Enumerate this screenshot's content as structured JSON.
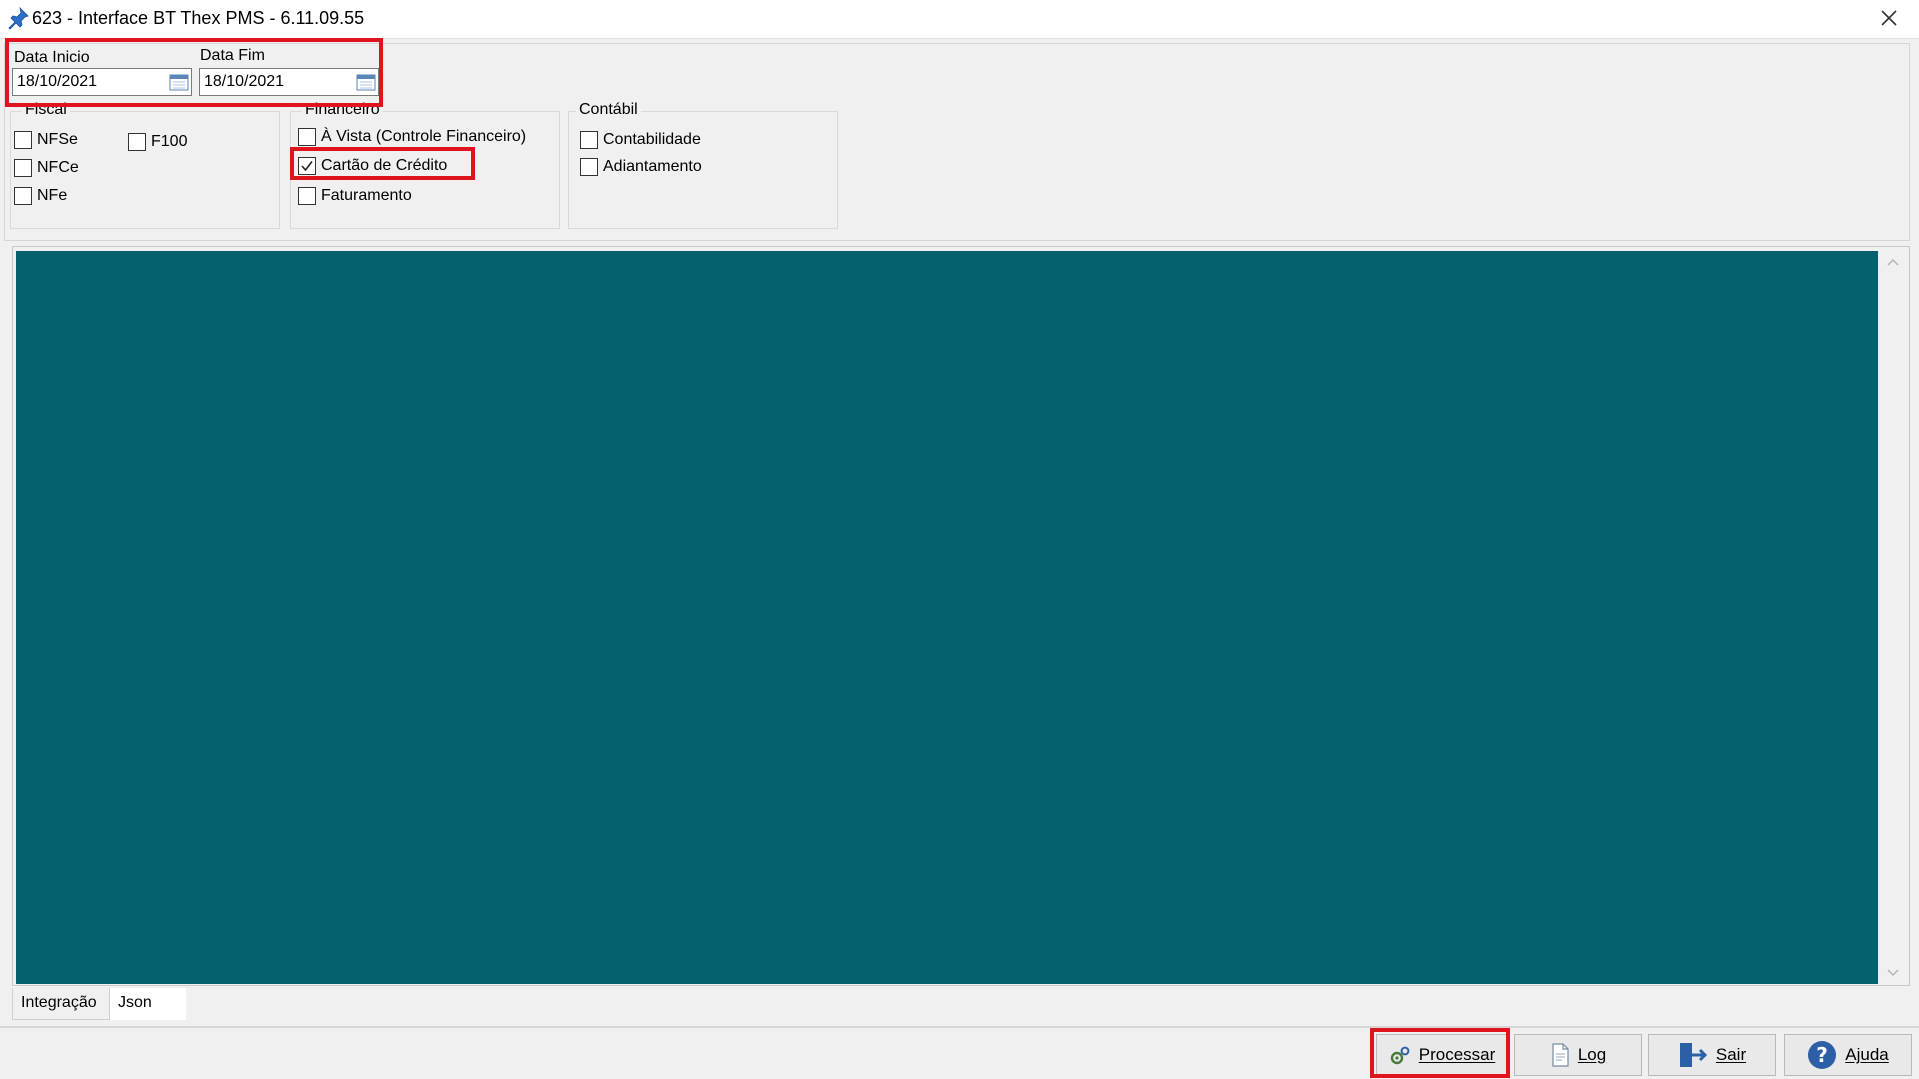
{
  "window": {
    "title": "623 - Interface BT Thex PMS - 6.11.09.55"
  },
  "dates": {
    "start_label": "Data Inicio",
    "start_value": "18/10/2021",
    "end_label": "Data Fim",
    "end_value": "18/10/2021"
  },
  "fiscal": {
    "title": "Fiscal",
    "items": [
      {
        "label": "NFSe",
        "checked": false
      },
      {
        "label": "NFCe",
        "checked": false
      },
      {
        "label": "NFe",
        "checked": false
      },
      {
        "label": "F100",
        "checked": false
      }
    ]
  },
  "financeiro": {
    "title": "Financeiro",
    "items": [
      {
        "label": "À Vista (Controle Financeiro)",
        "checked": false
      },
      {
        "label": "Cartão de Crédito",
        "checked": true
      },
      {
        "label": "Faturamento",
        "checked": false
      }
    ]
  },
  "contabil": {
    "title": "Contábil",
    "items": [
      {
        "label": "Contabilidade",
        "checked": false
      },
      {
        "label": "Adiantamento",
        "checked": false
      }
    ]
  },
  "tabs": [
    {
      "label": "Integração",
      "active": true
    },
    {
      "label": "Json",
      "active": false
    }
  ],
  "buttons": {
    "processar": "Processar",
    "log": "Log",
    "sair": "Sair",
    "ajuda": "Ajuda"
  },
  "colors": {
    "content_bg": "#05606d",
    "highlight": "#e0141e"
  }
}
